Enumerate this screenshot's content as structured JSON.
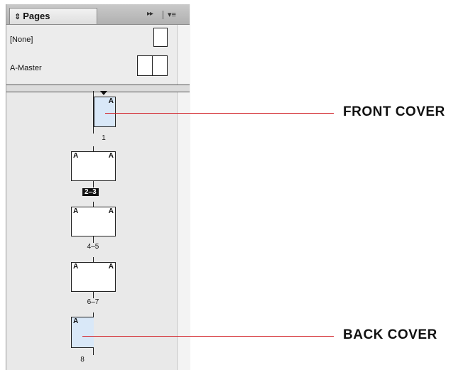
{
  "panel": {
    "tab_label": "Pages",
    "tab_arrows": "⇕",
    "collapse_icon": "▸▸",
    "menu_icon": "▾≡"
  },
  "masters": [
    {
      "label": "[None]",
      "type": "single"
    },
    {
      "label": "A-Master",
      "type": "spread"
    }
  ],
  "pages": [
    {
      "id": "p1",
      "number_label": "1",
      "prefix": "A",
      "selected": true,
      "highlighted": false
    },
    {
      "id": "p2-3",
      "number_label": "2–3",
      "prefix_left": "A",
      "prefix_right": "A",
      "selected": false,
      "highlighted": true
    },
    {
      "id": "p4-5",
      "number_label": "4–5",
      "prefix_left": "A",
      "prefix_right": "A",
      "selected": false,
      "highlighted": false
    },
    {
      "id": "p6-7",
      "number_label": "6–7",
      "prefix_left": "A",
      "prefix_right": "A",
      "selected": false,
      "highlighted": false
    },
    {
      "id": "p8",
      "number_label": "8",
      "prefix": "A",
      "selected": true,
      "highlighted": false
    }
  ],
  "callouts": {
    "front_cover": "FRONT COVER",
    "back_cover": "BACK COVER",
    "leader_color": "#d2232a"
  },
  "colors": {
    "selected_page": "#d9e8f8",
    "panel_bg": "#e9e9e9"
  }
}
